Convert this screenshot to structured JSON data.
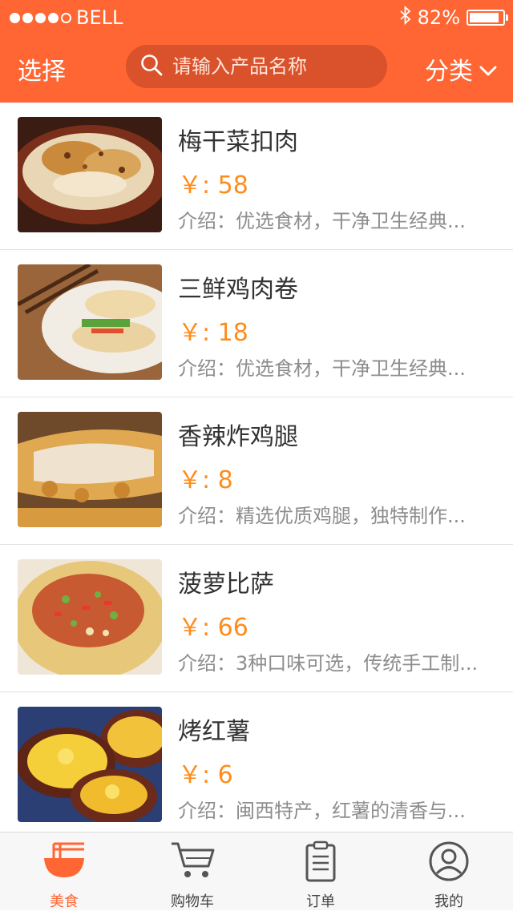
{
  "status_bar": {
    "carrier": "BELL",
    "battery": "82%",
    "battery_level": 0.82
  },
  "nav": {
    "select_label": "选择",
    "search_placeholder": "请输入产品名称",
    "category_label": "分类"
  },
  "products": [
    {
      "name": "梅干菜扣肉",
      "price": "￥: 58",
      "desc": "介绍：优选食材，干净卫生经典..."
    },
    {
      "name": "三鲜鸡肉卷",
      "price": "￥: 18",
      "desc": "介绍：优选食材，干净卫生经典..."
    },
    {
      "name": "香辣炸鸡腿",
      "price": "￥: 8",
      "desc": "介绍：精选优质鸡腿，独特制作..."
    },
    {
      "name": "菠萝比萨",
      "price": "￥: 66",
      "desc": "介绍：3种口味可选，传统手工制..."
    },
    {
      "name": "烤红薯",
      "price": "￥: 6",
      "desc": "介绍：闽西特产，红薯的清香与..."
    }
  ],
  "tabs": [
    {
      "label": "美食",
      "icon": "food-bowl-icon",
      "active": true
    },
    {
      "label": "购物车",
      "icon": "cart-icon",
      "active": false
    },
    {
      "label": "订单",
      "icon": "order-clipboard-icon",
      "active": false
    },
    {
      "label": "我的",
      "icon": "user-icon",
      "active": false
    }
  ],
  "colors": {
    "accent": "#ff6633",
    "price": "#ff8c1a",
    "search_bg": "#d9522b"
  }
}
